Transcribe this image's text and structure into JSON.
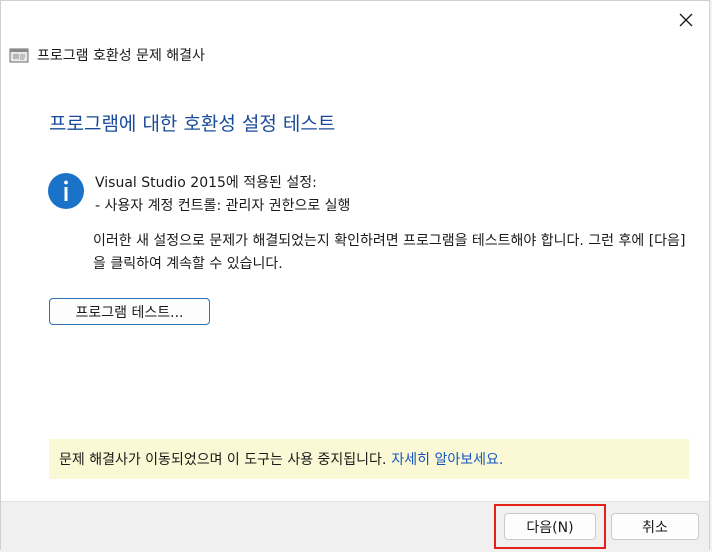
{
  "window": {
    "close_label": "✕",
    "title": "프로그램 호환성 문제 해결사",
    "title_icon": "app-window-icon"
  },
  "main": {
    "heading": "프로그램에 대한 호환성 설정 테스트",
    "info_icon": "info-icon",
    "settings_line1": "Visual Studio 2015에 적용된 설정:",
    "settings_line2": "- 사용자 계정 컨트롤:  관리자 권한으로 실행",
    "description": "이러한 새 설정으로 문제가 해결되었는지 확인하려면 프로그램을 테스트해야 합니다. 그런 후에 [다음]을 클릭하여 계속할 수 있습니다.",
    "test_button": "프로그램 테스트..."
  },
  "notice": {
    "text": "문제 해결사가 이동되었으며 이 도구는 사용 중지됩니다.",
    "link": "자세히 알아보세요."
  },
  "footer": {
    "next_button": "다음(N)",
    "cancel_button": "취소"
  },
  "colors": {
    "heading": "#1a4b9a",
    "link": "#1557c0",
    "notice_bg": "#fbf9d5",
    "highlight": "#e3201a",
    "info_icon": "#1a73c9"
  }
}
